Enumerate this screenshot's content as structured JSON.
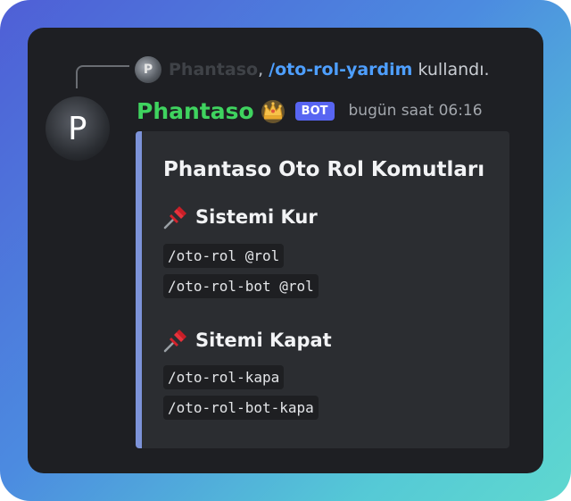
{
  "reply": {
    "avatar_letter": "P",
    "name": "Phantaso",
    "comma": ",",
    "command": "/oto-rol-yardim",
    "used_text": "kullandı."
  },
  "message": {
    "avatar_letter": "P",
    "author": "Phantaso",
    "author_color": "#3fd35f",
    "badge_icon": "crown-icon",
    "bot_tag": "BOT",
    "timestamp": "bugün saat 06:16"
  },
  "embed": {
    "accent_color": "#7d93d9",
    "title": "Phantaso Oto Rol Komutları",
    "sections": [
      {
        "icon": "pushpin-icon",
        "heading": "Sistemi Kur",
        "commands": [
          "/oto-rol @rol",
          "/oto-rol-bot @rol"
        ]
      },
      {
        "icon": "pushpin-icon",
        "heading": "Sitemi Kapat",
        "commands": [
          "/oto-rol-kapa",
          "/oto-rol-bot-kapa"
        ]
      }
    ]
  }
}
